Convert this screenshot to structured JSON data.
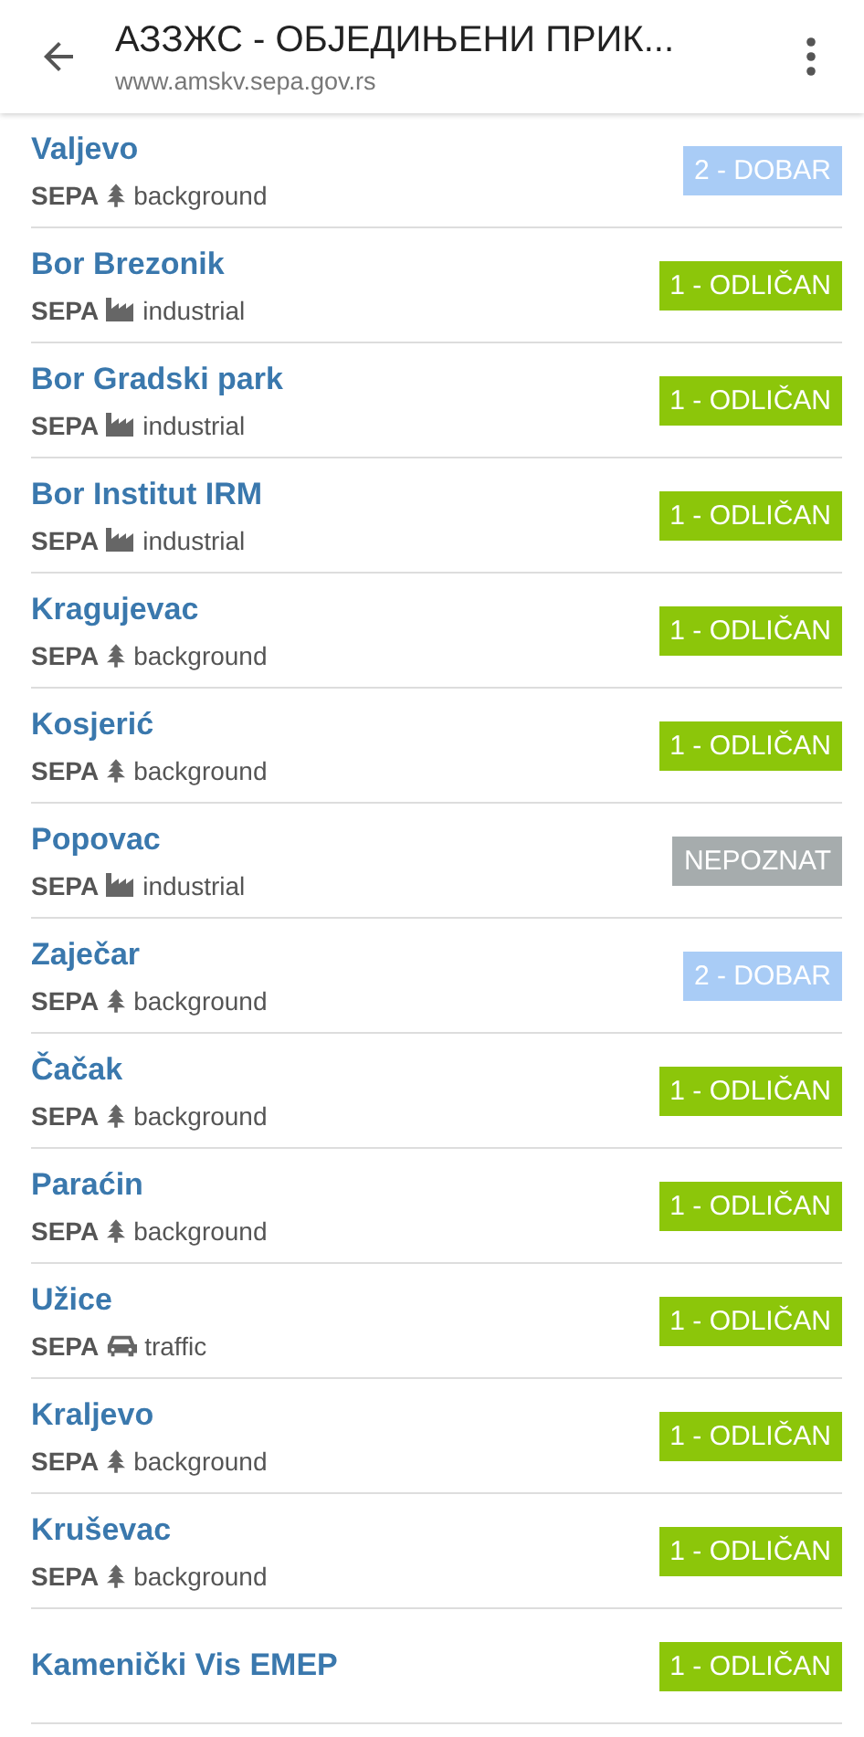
{
  "header": {
    "title": "АЗЗЖС - ОБЈЕДИЊЕНИ ПРИК...",
    "url": "www.amskv.sepa.gov.rs"
  },
  "stations": [
    {
      "name": "Valjevo",
      "network": "SEPA",
      "type": {
        "kind": "tree",
        "label": "background"
      },
      "quality": {
        "kind": "good",
        "label": "2 - DOBAR"
      }
    },
    {
      "name": "Bor Brezonik",
      "network": "SEPA",
      "type": {
        "kind": "factory",
        "label": "industrial"
      },
      "quality": {
        "kind": "excellent",
        "label": "1 - ODLIČAN"
      }
    },
    {
      "name": "Bor Gradski park",
      "network": "SEPA",
      "type": {
        "kind": "factory",
        "label": "industrial"
      },
      "quality": {
        "kind": "excellent",
        "label": "1 - ODLIČAN"
      }
    },
    {
      "name": "Bor Institut IRM",
      "network": "SEPA",
      "type": {
        "kind": "factory",
        "label": "industrial"
      },
      "quality": {
        "kind": "excellent",
        "label": "1 - ODLIČAN"
      }
    },
    {
      "name": "Kragujevac",
      "network": "SEPA",
      "type": {
        "kind": "tree",
        "label": "background"
      },
      "quality": {
        "kind": "excellent",
        "label": "1 - ODLIČAN"
      }
    },
    {
      "name": "Kosjerić",
      "network": "SEPA",
      "type": {
        "kind": "tree",
        "label": "background"
      },
      "quality": {
        "kind": "excellent",
        "label": "1 - ODLIČAN"
      }
    },
    {
      "name": "Popovac",
      "network": "SEPA",
      "type": {
        "kind": "factory",
        "label": "industrial"
      },
      "quality": {
        "kind": "unknown",
        "label": "NEPOZNAT"
      }
    },
    {
      "name": "Zaječar",
      "network": "SEPA",
      "type": {
        "kind": "tree",
        "label": "background"
      },
      "quality": {
        "kind": "good",
        "label": "2 - DOBAR"
      }
    },
    {
      "name": "Čačak",
      "network": "SEPA",
      "type": {
        "kind": "tree",
        "label": "background"
      },
      "quality": {
        "kind": "excellent",
        "label": "1 - ODLIČAN"
      }
    },
    {
      "name": "Paraćin",
      "network": "SEPA",
      "type": {
        "kind": "tree",
        "label": "background"
      },
      "quality": {
        "kind": "excellent",
        "label": "1 - ODLIČAN"
      }
    },
    {
      "name": "Užice",
      "network": "SEPA",
      "type": {
        "kind": "car",
        "label": "traffic"
      },
      "quality": {
        "kind": "excellent",
        "label": "1 - ODLIČAN"
      }
    },
    {
      "name": "Kraljevo",
      "network": "SEPA",
      "type": {
        "kind": "tree",
        "label": "background"
      },
      "quality": {
        "kind": "excellent",
        "label": "1 - ODLIČAN"
      }
    },
    {
      "name": "Kruševac",
      "network": "SEPA",
      "type": {
        "kind": "tree",
        "label": "background"
      },
      "quality": {
        "kind": "excellent",
        "label": "1 - ODLIČAN"
      }
    },
    {
      "name": "Kamenički Vis EMEP",
      "quality": {
        "kind": "excellent",
        "label": "1 - ODLIČAN"
      }
    }
  ]
}
